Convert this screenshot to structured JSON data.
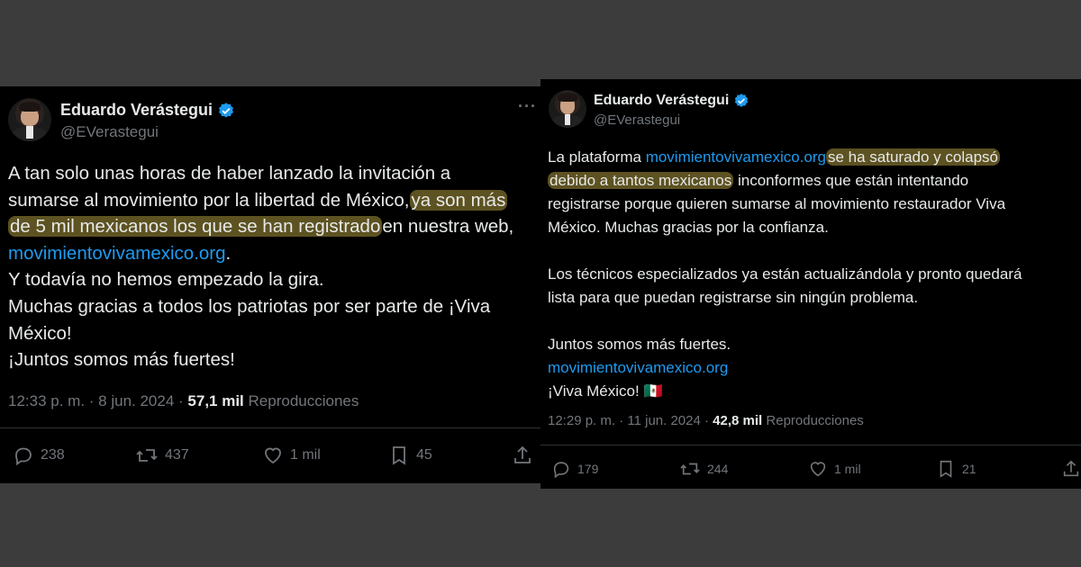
{
  "tweets": [
    {
      "author": "Eduardo Verástegui",
      "handle": "@EVerastegui",
      "more": "···",
      "body": {
        "l1": "A tan solo unas horas de haber lanzado la invitación a",
        "l2a": "sumarse al movimiento por la libertad de México,",
        "l2b": "ya son más",
        "l3a": "de 5 mil mexicanos los que se han registrado",
        "l3b": "en nuestra web,",
        "l4a": "movimientovivamexico.org",
        "l4b": ".",
        "l5": "Y todavía no hemos empezado la gira.",
        "l6": "Muchas gracias a todos los patriotas por ser parte de ¡Viva",
        "l7": "México!",
        "l8": "¡Juntos somos más fuertes!"
      },
      "meta": {
        "time": "12:33 p. m. · 8 jun. 2024 · ",
        "views": "57,1 mil",
        "views_label": "Reproducciones"
      },
      "actions": {
        "replies": "238",
        "reposts": "437",
        "likes": "1 mil",
        "bookmarks": "45"
      }
    },
    {
      "author": "Eduardo Verástegui",
      "handle": "@EVerastegui",
      "more": "···",
      "body": {
        "l1a": "La plataforma",
        "l1b": "movimientovivamexico.org",
        "l1c": "se ha saturado y colapsó",
        "l2a": "debido a tantos mexicanos",
        "l2b": "inconformes que están intentando",
        "l3": "registrarse porque quieren sumarse al movimiento restaurador Viva",
        "l4": "México. Muchas gracias por la confianza.",
        "l5": "Los técnicos especializados ya están actualizándola y pronto quedará",
        "l6": "lista para que puedan registrarse sin ningún problema.",
        "l7": "Juntos somos más fuertes.",
        "l8": "movimientovivamexico.org",
        "l9": "¡Viva México!",
        "flag": "🇲🇽"
      },
      "meta": {
        "time": "12:29 p. m. · 11 jun. 2024 · ",
        "views": "42,8 mil",
        "views_label": "Reproducciones"
      },
      "actions": {
        "replies": "179",
        "reposts": "244",
        "likes": "1 mil",
        "bookmarks": "21"
      }
    }
  ],
  "colors": {
    "background": "#000000",
    "text": "#e7e9ea",
    "secondary": "#71767b",
    "link": "#1d9bf0",
    "verified": "#1d9bf0",
    "highlight": "#aa963c"
  },
  "icons": [
    "verified-badge-icon",
    "more-icon",
    "reply-icon",
    "repost-icon",
    "like-icon",
    "bookmark-icon",
    "share-icon"
  ]
}
